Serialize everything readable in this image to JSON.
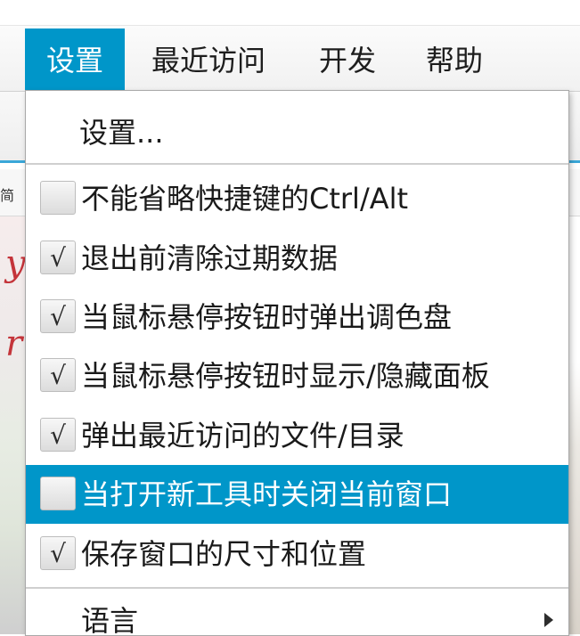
{
  "menubar": {
    "items": [
      {
        "label": "设置"
      },
      {
        "label": "最近访问"
      },
      {
        "label": "开发"
      },
      {
        "label": "帮助"
      }
    ],
    "active_color": "#0096c9"
  },
  "background": {
    "subbar_text": "简"
  },
  "dropdown": {
    "settings_label": "设置...",
    "checks": [
      {
        "label": "不能省略快捷键的Ctrl/Alt",
        "checked": false,
        "mark": ""
      },
      {
        "label": "退出前清除过期数据",
        "checked": true,
        "mark": "√"
      },
      {
        "label": "当鼠标悬停按钮时弹出调色盘",
        "checked": true,
        "mark": "√"
      },
      {
        "label": "当鼠标悬停按钮时显示/隐藏面板",
        "checked": true,
        "mark": "√"
      },
      {
        "label": "弹出最近访问的文件/目录",
        "checked": true,
        "mark": "√"
      },
      {
        "label": "当打开新工具时关闭当前窗口",
        "checked": false,
        "mark": "",
        "highlighted": true
      },
      {
        "label": "保存窗口的尺寸和位置",
        "checked": true,
        "mark": "√"
      }
    ],
    "language_label": "语言",
    "highlight_color": "#0096c9"
  }
}
